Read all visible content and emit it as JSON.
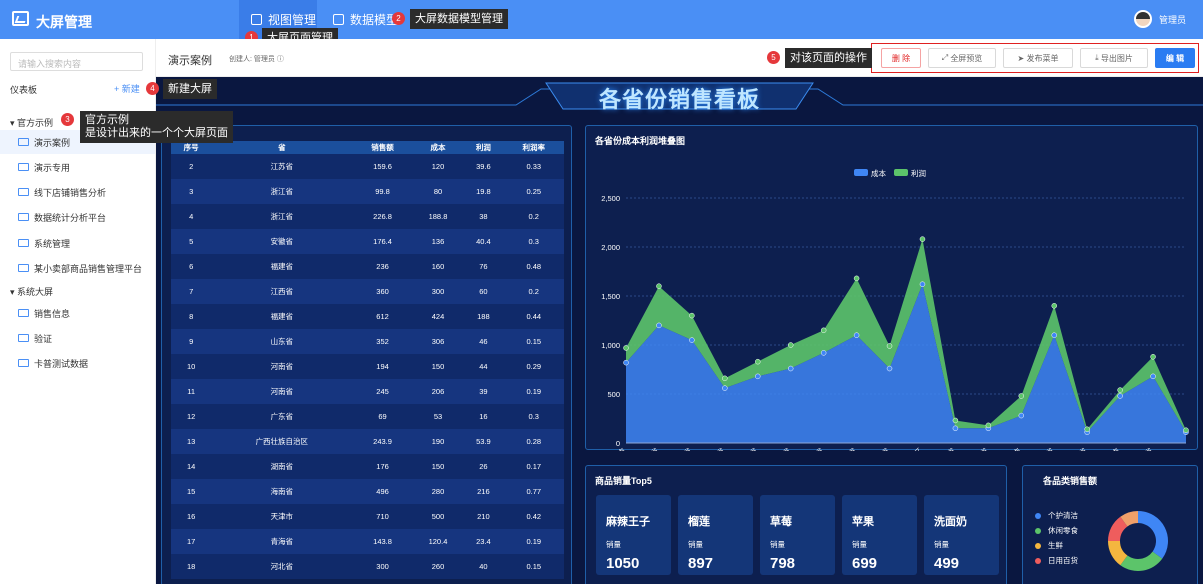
{
  "app": {
    "title": "大屏管理",
    "user": "管理员"
  },
  "nav": [
    {
      "label": "视图管理"
    },
    {
      "label": "数据模型"
    }
  ],
  "tips": {
    "t1": "大屏页面管理",
    "t2": "大屏数据模型管理",
    "t3a": "官方示例",
    "t3b": "是设计出来的一个个大屏页面",
    "t4": "新建大屏",
    "t5": "对该页面的操作"
  },
  "badges": [
    "1",
    "2",
    "3",
    "4",
    "5"
  ],
  "sidebar": {
    "search_placeholder": "请输入搜索内容",
    "title": "仪表板",
    "new_label": "+ 新建",
    "group1": "官方示例",
    "group2": "系统大屏",
    "items1": [
      "演示案例",
      "演示专用",
      "线下店铺销售分析",
      "数据统计分析平台",
      "系统管理",
      "某小卖部商品销售管理平台"
    ],
    "items2": [
      "销售信息",
      "验证",
      "卡普测试数据"
    ]
  },
  "toolbar": {
    "title": "演示案例",
    "creator": "创建人: 管理员 ⓘ",
    "delete": "删 除",
    "preview": "全屏预览",
    "publish": "发布菜单",
    "export": "导出图片",
    "edit": "编 辑"
  },
  "screen": {
    "title": "各省份销售看板",
    "chart_title": "各省份成本利润堆叠图",
    "top5_title": "商品销量Top5",
    "cat_title": "各品类销售额"
  },
  "table": {
    "headers": [
      "序号",
      "省",
      "销售额",
      "成本",
      "利润",
      "利润率"
    ],
    "rows": [
      [
        "2",
        "江苏省",
        "159.6",
        "120",
        "39.6",
        "0.33"
      ],
      [
        "3",
        "浙江省",
        "99.8",
        "80",
        "19.8",
        "0.25"
      ],
      [
        "4",
        "浙江省",
        "226.8",
        "188.8",
        "38",
        "0.2"
      ],
      [
        "5",
        "安徽省",
        "176.4",
        "136",
        "40.4",
        "0.3"
      ],
      [
        "6",
        "福建省",
        "236",
        "160",
        "76",
        "0.48"
      ],
      [
        "7",
        "江西省",
        "360",
        "300",
        "60",
        "0.2"
      ],
      [
        "8",
        "福建省",
        "612",
        "424",
        "188",
        "0.44"
      ],
      [
        "9",
        "山东省",
        "352",
        "306",
        "46",
        "0.15"
      ],
      [
        "10",
        "河南省",
        "194",
        "150",
        "44",
        "0.29"
      ],
      [
        "11",
        "河南省",
        "245",
        "206",
        "39",
        "0.19"
      ],
      [
        "12",
        "广东省",
        "69",
        "53",
        "16",
        "0.3"
      ],
      [
        "13",
        "广西壮族自治区",
        "243.9",
        "190",
        "53.9",
        "0.28"
      ],
      [
        "14",
        "湖南省",
        "176",
        "150",
        "26",
        "0.17"
      ],
      [
        "15",
        "海南省",
        "496",
        "280",
        "216",
        "0.77"
      ],
      [
        "16",
        "天津市",
        "710",
        "500",
        "210",
        "0.42"
      ],
      [
        "17",
        "青海省",
        "143.8",
        "120.4",
        "23.4",
        "0.19"
      ],
      [
        "18",
        "河北省",
        "300",
        "260",
        "40",
        "0.15"
      ]
    ]
  },
  "top5": [
    {
      "name": "麻辣王子",
      "label": "销量",
      "value": "1050"
    },
    {
      "name": "榴莲",
      "label": "销量",
      "value": "897"
    },
    {
      "name": "草莓",
      "label": "销量",
      "value": "798"
    },
    {
      "name": "苹果",
      "label": "销量",
      "value": "699"
    },
    {
      "name": "洗面奶",
      "label": "销量",
      "value": "499"
    }
  ],
  "categories": [
    {
      "name": "个护清洁",
      "color": "#3f86f5"
    },
    {
      "name": "休闲零食",
      "color": "#5cc46a"
    },
    {
      "name": "生鲜",
      "color": "#f4b63f"
    },
    {
      "name": "日用百货",
      "color": "#ef5d5d"
    }
  ],
  "chart_data": {
    "type": "area",
    "categories": [
      "北京市",
      "江苏省",
      "浙江省",
      "安徽省",
      "福建省",
      "江西省",
      "山东省",
      "河南省",
      "广东省",
      "广西壮族自治区",
      "湖南省",
      "海南省",
      "天津市",
      "青海省",
      "河北省",
      "上海市",
      "陕西省"
    ],
    "series": [
      {
        "name": "成本",
        "color": "#3f86f5",
        "values": [
          820,
          1200,
          1050,
          560,
          680,
          760,
          920,
          1100,
          760,
          1620,
          150,
          150,
          280,
          1100,
          110,
          480,
          680,
          110
        ]
      },
      {
        "name": "利润",
        "color": "#5cc46a",
        "values": [
          150,
          400,
          250,
          100,
          150,
          240,
          230,
          580,
          230,
          460,
          80,
          30,
          200,
          300,
          30,
          60,
          200,
          20
        ]
      }
    ],
    "ylim": [
      0,
      2500
    ],
    "yticks": [
      "0",
      "500",
      "1,000",
      "1,500",
      "2,000",
      "2,500"
    ],
    "legend": "top"
  },
  "pie": {
    "values": [
      35,
      25,
      15,
      15,
      10
    ]
  }
}
